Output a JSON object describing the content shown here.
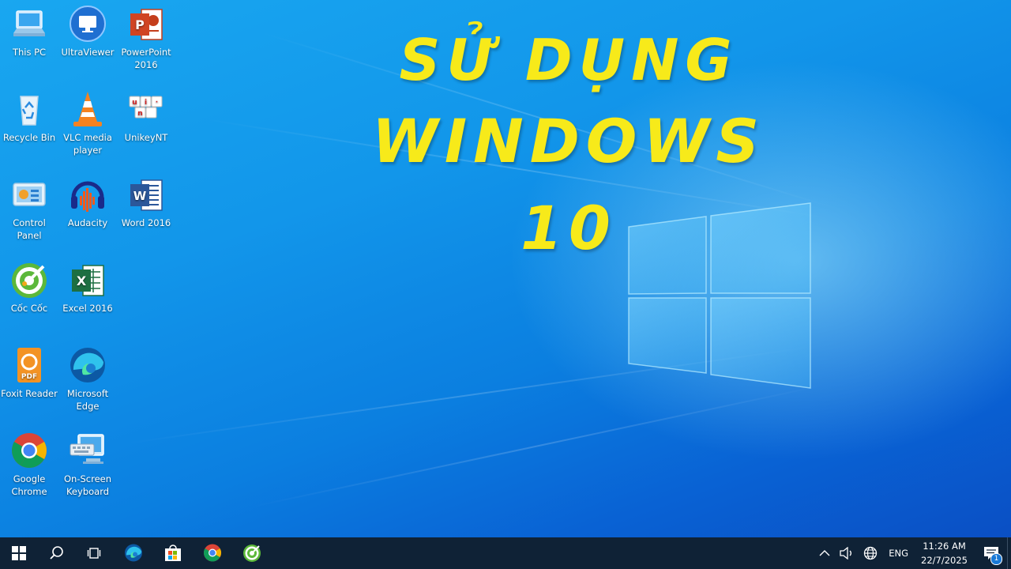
{
  "headline": {
    "line1": "SỬ DỤNG",
    "line2": "WINDOWS 10"
  },
  "desktop_icons": [
    {
      "label": "This PC",
      "icon": "this-pc-icon"
    },
    {
      "label": "UltraViewer",
      "icon": "ultraviewer-icon"
    },
    {
      "label": "PowerPoint 2016",
      "icon": "powerpoint-icon"
    },
    {
      "label": "Recycle Bin",
      "icon": "recycle-bin-icon"
    },
    {
      "label": "VLC media player",
      "icon": "vlc-icon"
    },
    {
      "label": "UnikeyNT",
      "icon": "unikey-icon"
    },
    {
      "label": "Control Panel",
      "icon": "control-panel-icon"
    },
    {
      "label": "Audacity",
      "icon": "audacity-icon"
    },
    {
      "label": "Word 2016",
      "icon": "word-icon"
    },
    {
      "label": "Cốc Cốc",
      "icon": "coccoc-icon"
    },
    {
      "label": "Excel 2016",
      "icon": "excel-icon"
    },
    {
      "label": "Foxit Reader",
      "icon": "foxit-icon"
    },
    {
      "label": "Microsoft Edge",
      "icon": "edge-icon"
    },
    {
      "label": "Google Chrome",
      "icon": "chrome-icon"
    },
    {
      "label": "On-Screen Keyboard",
      "icon": "onscreen-keyboard-icon"
    }
  ],
  "taskbar": {
    "pinned": [
      "start-icon",
      "search-icon",
      "task-view-icon",
      "edge-icon",
      "store-icon",
      "chrome-icon",
      "coccoc-icon"
    ],
    "tray": {
      "language": "ENG",
      "time": "11:26 AM",
      "date": "22/7/2025",
      "notification_count": "1"
    }
  },
  "colors": {
    "headline": "#f7ea1a",
    "taskbar": "#0f2236",
    "desktop": "#1296ea"
  }
}
